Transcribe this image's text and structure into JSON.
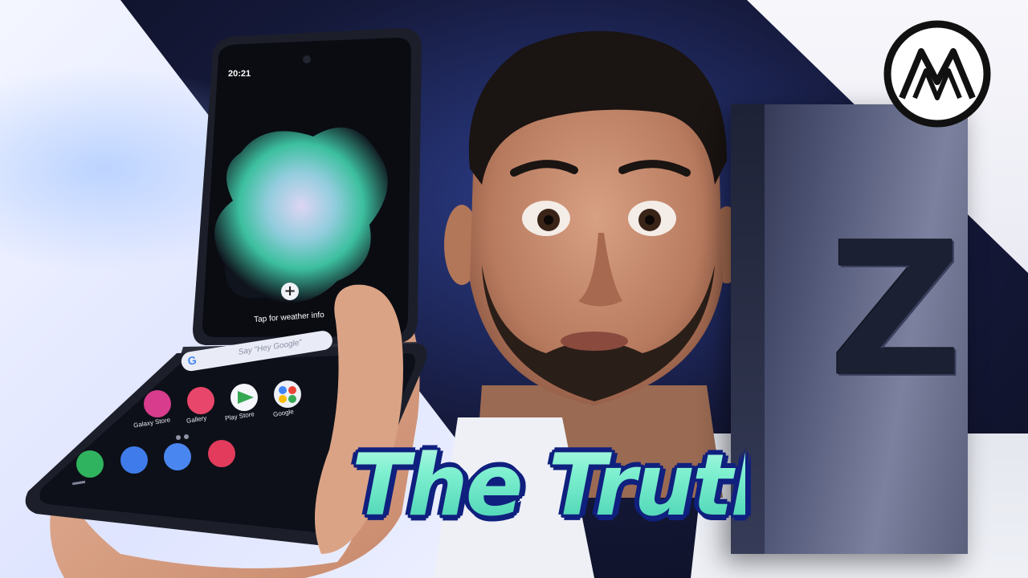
{
  "title": "The Truth",
  "phone": {
    "time": "20:21",
    "weather_prompt": "Tap for weather info",
    "search_placeholder": "Say \"Hey Google\"",
    "search_logo": "G",
    "apps": [
      "Galaxy Store",
      "Gallery",
      "Play Store",
      "Google"
    ]
  },
  "box_letter": "Z",
  "logo_icon": "mountain-logo-icon",
  "colors": {
    "title_fill": "#7ff0c9",
    "title_outline": "#10207e",
    "background_dark": "#15193a"
  }
}
